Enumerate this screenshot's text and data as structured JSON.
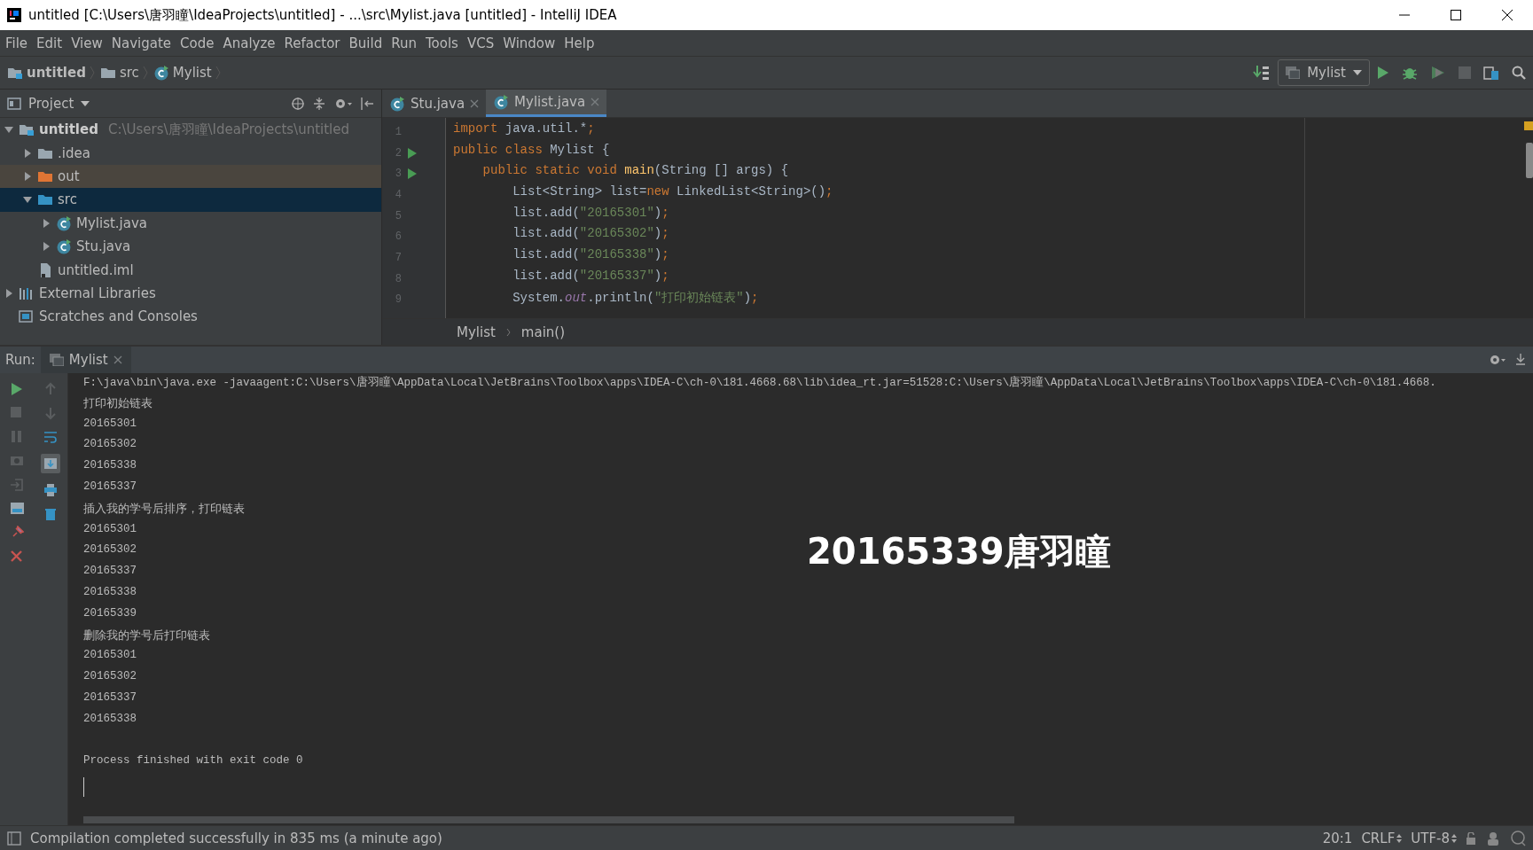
{
  "window": {
    "title": "untitled [C:\\Users\\唐羽瞳\\IdeaProjects\\untitled] - ...\\src\\Mylist.java [untitled] - IntelliJ IDEA"
  },
  "menu": [
    "File",
    "Edit",
    "View",
    "Navigate",
    "Code",
    "Analyze",
    "Refactor",
    "Build",
    "Run",
    "Tools",
    "VCS",
    "Window",
    "Help"
  ],
  "navbar": {
    "crumbs": [
      {
        "label": "untitled",
        "kind": "module"
      },
      {
        "label": "src",
        "kind": "folder"
      },
      {
        "label": "Mylist",
        "kind": "class"
      }
    ],
    "run_config": "Mylist"
  },
  "project": {
    "title": "Project",
    "tree": [
      {
        "label": "untitled",
        "kind": "module",
        "path": "C:\\Users\\唐羽瞳\\IdeaProjects\\untitled",
        "expanded": true,
        "selected": false,
        "children": [
          {
            "label": ".idea",
            "kind": "folder",
            "expanded": false,
            "selected": false
          },
          {
            "label": "out",
            "kind": "excluded-folder",
            "expanded": false,
            "selected": false
          },
          {
            "label": "src",
            "kind": "source-folder",
            "expanded": true,
            "selected": true,
            "children": [
              {
                "label": "Mylist.java",
                "kind": "class",
                "expanded": false,
                "selected": false
              },
              {
                "label": "Stu.java",
                "kind": "class",
                "expanded": false,
                "selected": false
              }
            ]
          },
          {
            "label": "untitled.iml",
            "kind": "iml",
            "selected": false
          }
        ]
      },
      {
        "label": "External Libraries",
        "kind": "libraries",
        "expanded": false,
        "selected": false
      },
      {
        "label": "Scratches and Consoles",
        "kind": "scratches",
        "selected": false
      }
    ]
  },
  "editor": {
    "tabs": [
      {
        "label": "Stu.java",
        "selected": false
      },
      {
        "label": "Mylist.java",
        "selected": true
      }
    ],
    "lines": [
      {
        "number": "1",
        "run_marker": false,
        "tokens": [
          {
            "kind": "keyword",
            "text": "import"
          },
          {
            "kind": "plain",
            "text": " java.util.*"
          },
          {
            "kind": "keyword",
            "text": ";"
          }
        ]
      },
      {
        "number": "2",
        "run_marker": true,
        "tokens": [
          {
            "kind": "keyword",
            "text": "public class "
          },
          {
            "kind": "plain",
            "text": "Mylist {"
          }
        ]
      },
      {
        "number": "3",
        "run_marker": true,
        "tokens": [
          {
            "kind": "keyword",
            "text": "    public static void "
          },
          {
            "kind": "method",
            "text": "main"
          },
          {
            "kind": "plain",
            "text": "(String [] args) {"
          }
        ]
      },
      {
        "number": "4",
        "run_marker": false,
        "tokens": [
          {
            "kind": "plain",
            "text": "        List<String> list="
          },
          {
            "kind": "keyword",
            "text": "new"
          },
          {
            "kind": "plain",
            "text": " LinkedList<String>()"
          },
          {
            "kind": "keyword",
            "text": ";"
          }
        ]
      },
      {
        "number": "5",
        "run_marker": false,
        "tokens": [
          {
            "kind": "plain",
            "text": "        list.add("
          },
          {
            "kind": "string",
            "text": "\"20165301\""
          },
          {
            "kind": "plain",
            "text": ")"
          },
          {
            "kind": "keyword",
            "text": ";"
          }
        ]
      },
      {
        "number": "6",
        "run_marker": false,
        "tokens": [
          {
            "kind": "plain",
            "text": "        list.add("
          },
          {
            "kind": "string",
            "text": "\"20165302\""
          },
          {
            "kind": "plain",
            "text": ")"
          },
          {
            "kind": "keyword",
            "text": ";"
          }
        ]
      },
      {
        "number": "7",
        "run_marker": false,
        "tokens": [
          {
            "kind": "plain",
            "text": "        list.add("
          },
          {
            "kind": "string",
            "text": "\"20165338\""
          },
          {
            "kind": "plain",
            "text": ")"
          },
          {
            "kind": "keyword",
            "text": ";"
          }
        ]
      },
      {
        "number": "8",
        "run_marker": false,
        "tokens": [
          {
            "kind": "plain",
            "text": "        list.add("
          },
          {
            "kind": "string",
            "text": "\"20165337\""
          },
          {
            "kind": "plain",
            "text": ")"
          },
          {
            "kind": "keyword",
            "text": ";"
          }
        ]
      },
      {
        "number": "9",
        "run_marker": false,
        "tokens": [
          {
            "kind": "plain",
            "text": "        System."
          },
          {
            "kind": "field",
            "text": "out"
          },
          {
            "kind": "plain",
            "text": ".println("
          },
          {
            "kind": "string",
            "text": "\"打印初始链表\""
          },
          {
            "kind": "plain",
            "text": ")"
          },
          {
            "kind": "keyword",
            "text": ";"
          }
        ]
      }
    ],
    "breadcrumbs": [
      "Mylist",
      "main()"
    ]
  },
  "run": {
    "label": "Run:",
    "tab": "Mylist",
    "console": [
      {
        "kind": "output",
        "text": "F:\\java\\bin\\java.exe -javaagent:C:\\Users\\唐羽瞳\\AppData\\Local\\JetBrains\\Toolbox\\apps\\IDEA-C\\ch-0\\181.4668.68\\lib\\idea_rt.jar=51528:C:\\Users\\唐羽瞳\\AppData\\Local\\JetBrains\\Toolbox\\apps\\IDEA-C\\ch-0\\181.4668."
      },
      {
        "kind": "output",
        "text": "打印初始链表"
      },
      {
        "kind": "output",
        "text": "20165301"
      },
      {
        "kind": "output",
        "text": "20165302"
      },
      {
        "kind": "output",
        "text": "20165338"
      },
      {
        "kind": "output",
        "text": "20165337"
      },
      {
        "kind": "output",
        "text": "插入我的学号后排序，打印链表"
      },
      {
        "kind": "output",
        "text": "20165301"
      },
      {
        "kind": "output",
        "text": "20165302"
      },
      {
        "kind": "output",
        "text": "20165337"
      },
      {
        "kind": "output",
        "text": "20165338"
      },
      {
        "kind": "output",
        "text": "20165339"
      },
      {
        "kind": "output",
        "text": "删除我的学号后打印链表"
      },
      {
        "kind": "output",
        "text": "20165301"
      },
      {
        "kind": "output",
        "text": "20165302"
      },
      {
        "kind": "output",
        "text": "20165337"
      },
      {
        "kind": "output",
        "text": "20165338"
      },
      {
        "kind": "exit",
        "text": "Process finished with exit code 0"
      }
    ],
    "overlay_caption": "20165339唐羽瞳"
  },
  "status_bar": {
    "message": "Compilation completed successfully in 835 ms (a minute ago)",
    "position": "20:1",
    "line_separator": "CRLF",
    "encoding": "UTF-8"
  }
}
